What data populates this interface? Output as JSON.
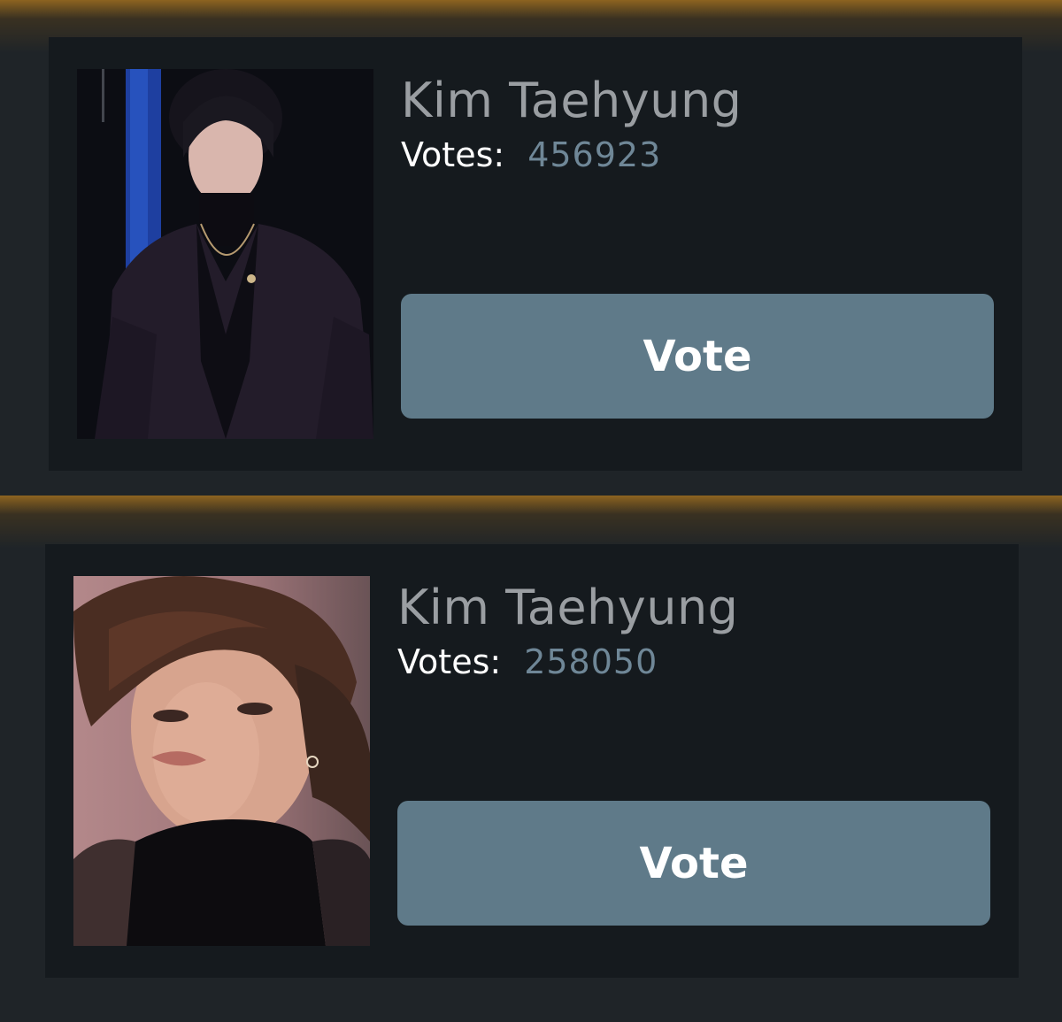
{
  "colors": {
    "background": "#1f2428",
    "card": "#151a1e",
    "glow": "#a06e1e",
    "button": "#5f7a89",
    "name_text": "#9a9ea2",
    "votes_count_text": "#6f8797"
  },
  "candidates": [
    {
      "name": "Kim Taehyung",
      "votes_label": "Votes:",
      "votes_count": "456923",
      "vote_button_label": "Vote",
      "photo_icon": "candidate-photo"
    },
    {
      "name": "Kim Taehyung",
      "votes_label": "Votes:",
      "votes_count": "258050",
      "vote_button_label": "Vote",
      "photo_icon": "candidate-photo"
    }
  ]
}
